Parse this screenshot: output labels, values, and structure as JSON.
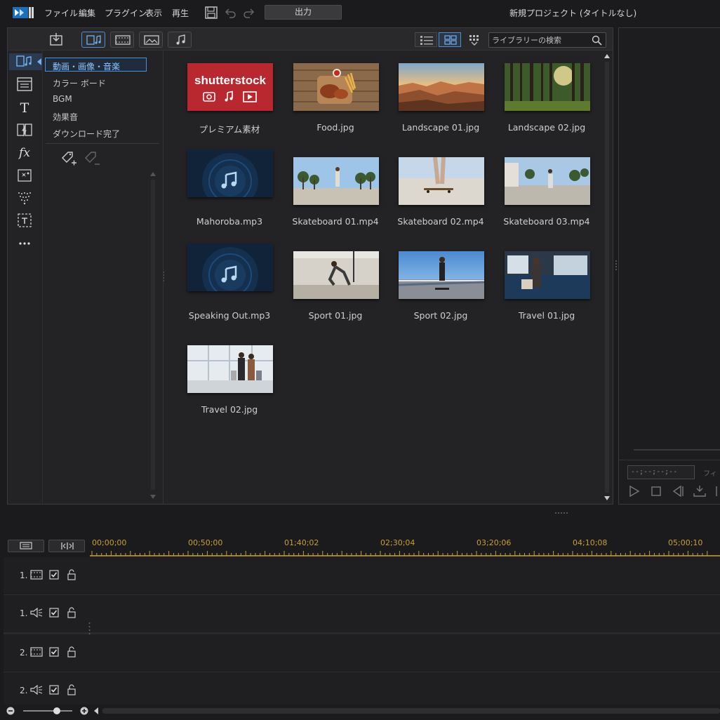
{
  "app": {
    "menu": [
      "ファイル",
      "編集",
      "プラグイン",
      "表示",
      "再生"
    ],
    "output_button": "出力",
    "project_title": "新規プロジェクト (タイトルなし)"
  },
  "library": {
    "search_placeholder": "ライブラリーの検索",
    "categories": [
      "動画・画像・音楽",
      "カラー ボード",
      "BGM",
      "効果音",
      "ダウンロード完了"
    ],
    "media": [
      {
        "name": "プレミアム素材"
      },
      {
        "name": "Food.jpg"
      },
      {
        "name": "Landscape 01.jpg"
      },
      {
        "name": "Landscape 02.jpg"
      },
      {
        "name": "Mahoroba.mp3"
      },
      {
        "name": "Skateboard 01.mp4"
      },
      {
        "name": "Skateboard 02.mp4"
      },
      {
        "name": "Skateboard 03.mp4"
      },
      {
        "name": "Speaking Out.mp3"
      },
      {
        "name": "Sport 01.jpg"
      },
      {
        "name": "Sport 02.jpg"
      },
      {
        "name": "Travel 01.jpg"
      },
      {
        "name": "Travel 02.jpg"
      }
    ],
    "shutterstock_logo": "shutterstock"
  },
  "preview": {
    "timecode": "--;--;--;--",
    "filter_label": "フィ"
  },
  "timeline": {
    "ruler": [
      "00;00;00",
      "00;50;00",
      "01;40;02",
      "02;30;04",
      "03;20;06",
      "04;10;08",
      "05;00;10"
    ],
    "tracks": [
      {
        "num": "1.",
        "type": "video"
      },
      {
        "num": "1.",
        "type": "audio"
      },
      {
        "num": "2.",
        "type": "video"
      },
      {
        "num": "2.",
        "type": "audio"
      }
    ]
  },
  "colors": {
    "accent": "#4a90d9",
    "ruler_gold": "#c8a030",
    "shutterstock_red": "#b8282e"
  }
}
